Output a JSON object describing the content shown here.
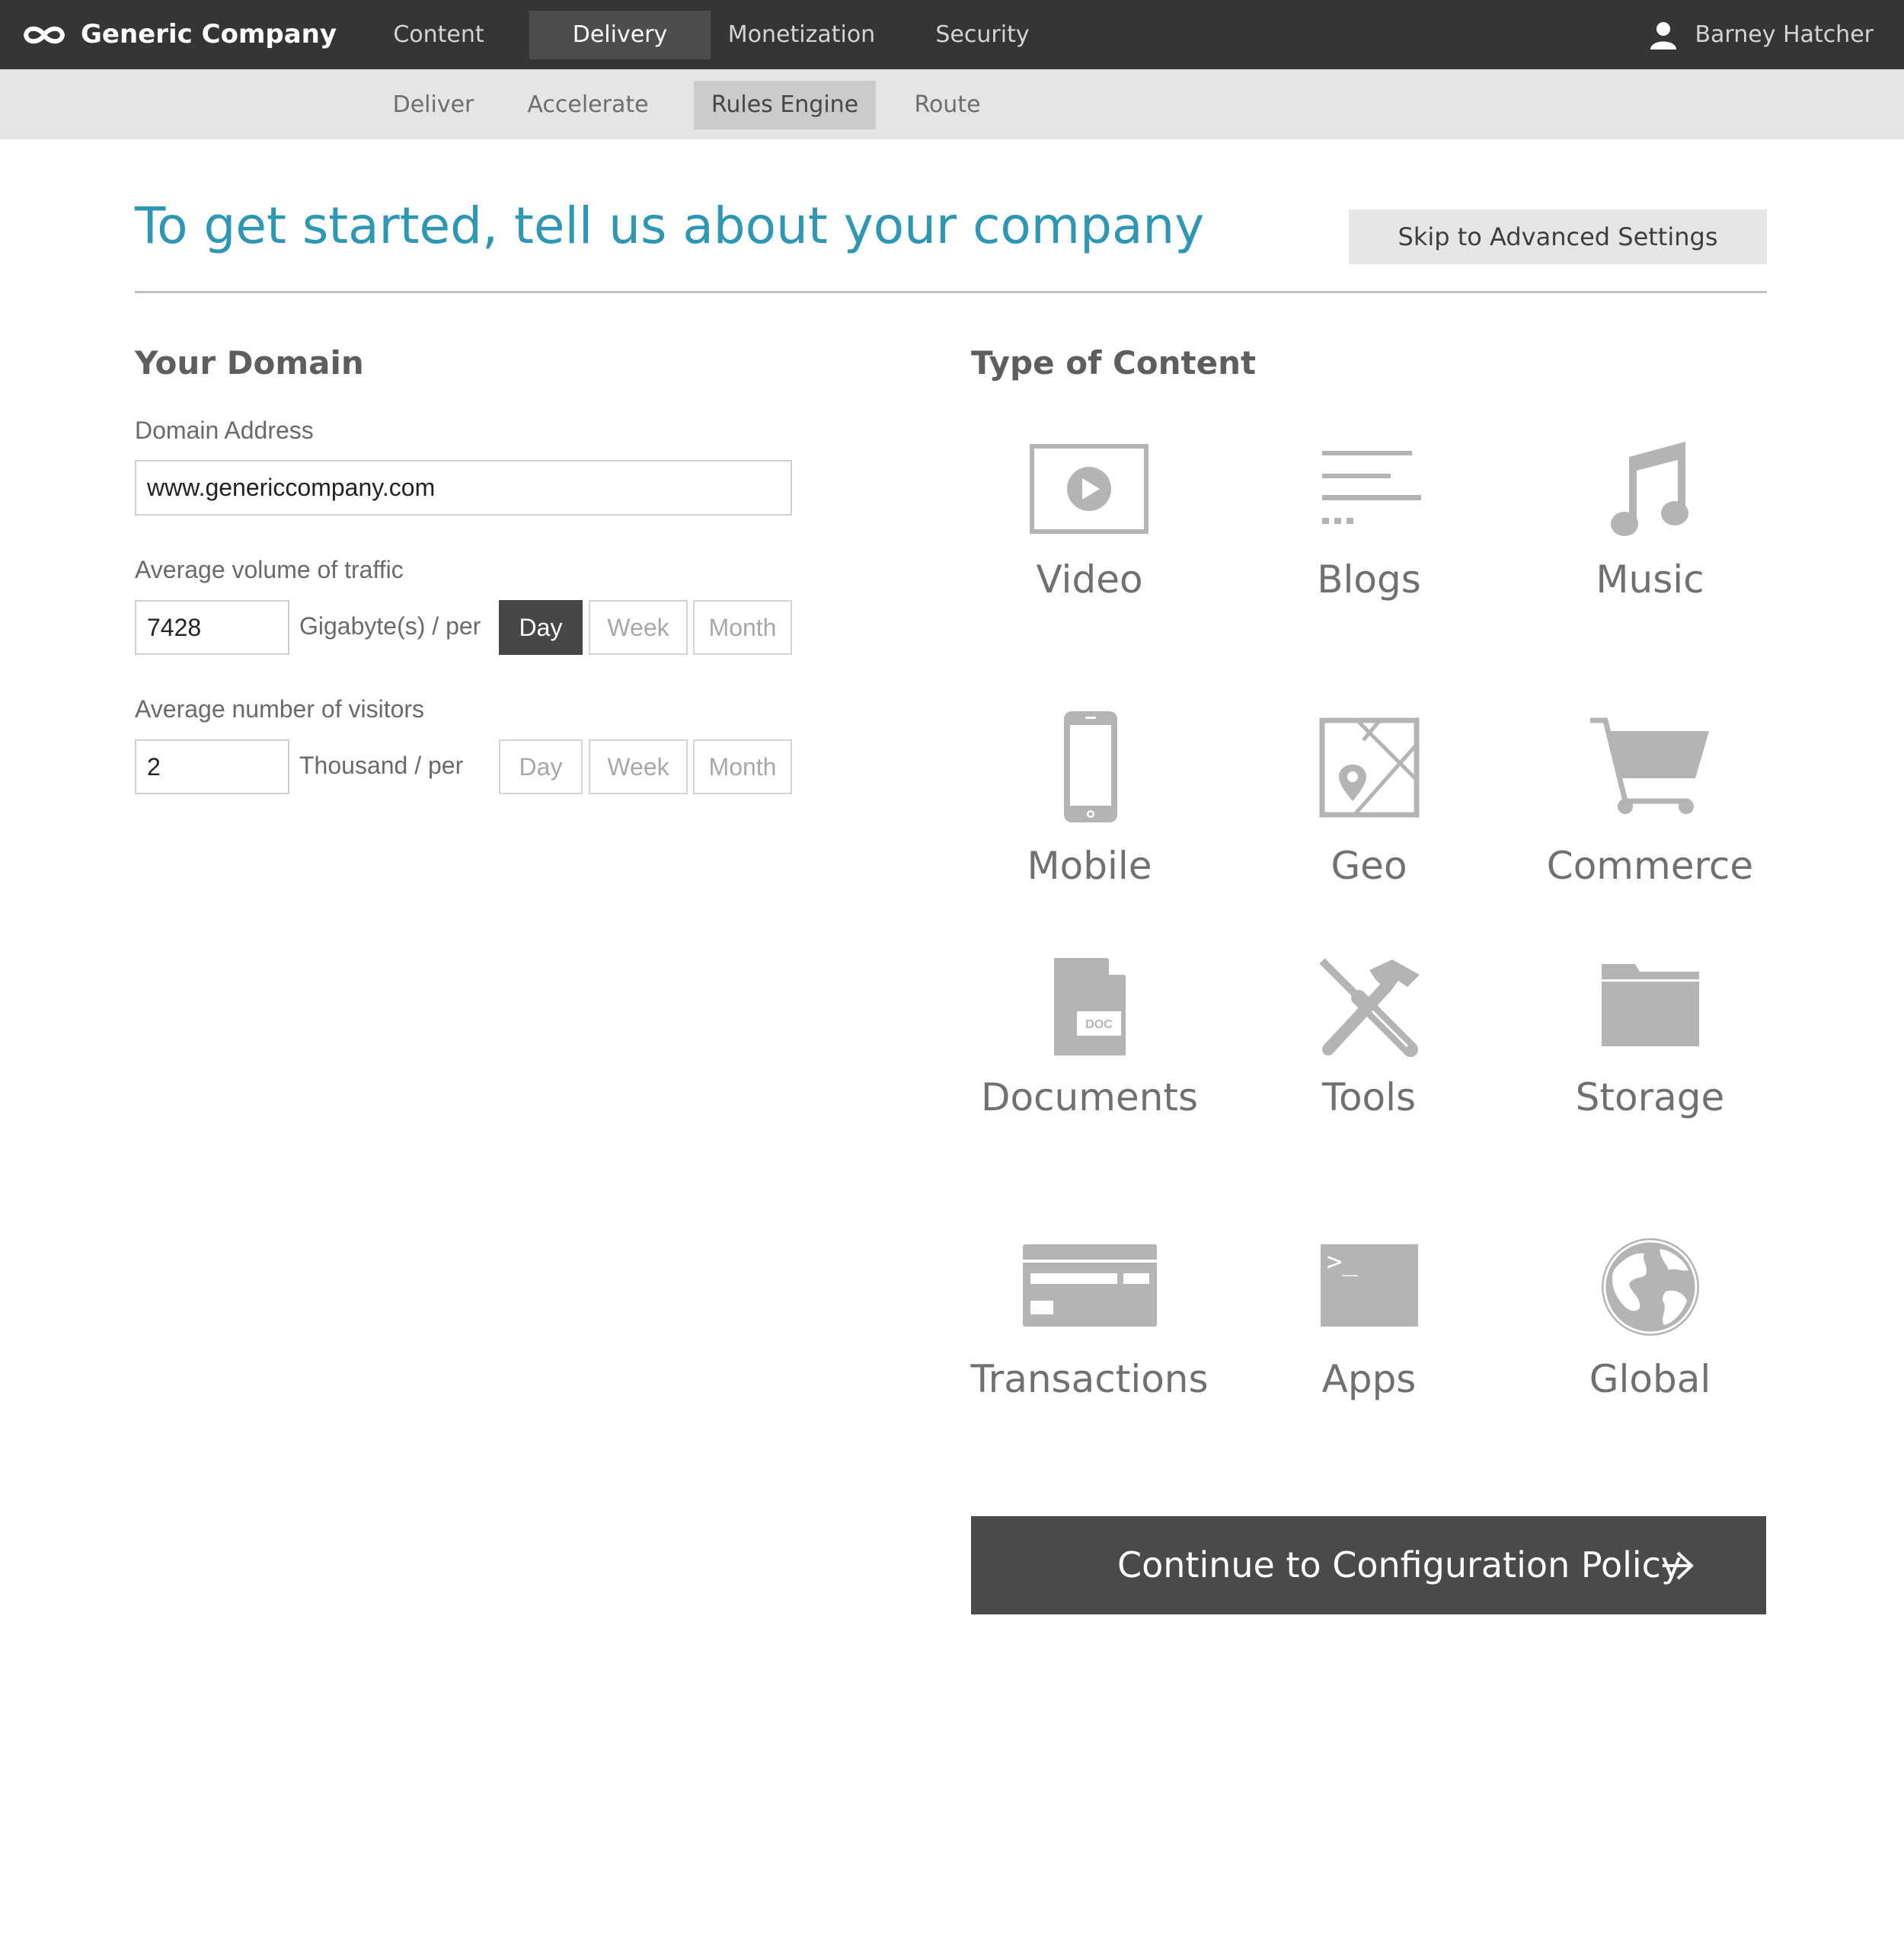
{
  "header": {
    "brand": "Generic Company",
    "logo_icon": "infinity-icon",
    "tabs": [
      {
        "label": "Content",
        "active": false
      },
      {
        "label": "Delivery",
        "active": true
      },
      {
        "label": "Monetization",
        "active": false
      },
      {
        "label": "Security",
        "active": false
      }
    ],
    "user": {
      "name": "Barney Hatcher",
      "icon": "user-icon"
    }
  },
  "subnav": {
    "tabs": [
      {
        "label": "Deliver",
        "active": false
      },
      {
        "label": "Accelerate",
        "active": false
      },
      {
        "label": "Rules Engine",
        "active": true
      },
      {
        "label": "Route",
        "active": false
      }
    ]
  },
  "page": {
    "title": "To get started, tell us about your company",
    "skip_label": "Skip to Advanced Settings"
  },
  "domain_section": {
    "title": "Your Domain",
    "domain_label": "Domain Address",
    "domain_value": "www.genericcompany.com",
    "traffic": {
      "label": "Average volume of traffic",
      "value": "7428",
      "unit": "Gigabyte(s) / per",
      "periods": [
        "Day",
        "Week",
        "Month"
      ],
      "selected": "Day"
    },
    "visitors": {
      "label": "Average number of visitors",
      "value": "2",
      "unit": "Thousand / per",
      "periods": [
        "Day",
        "Week",
        "Month"
      ],
      "selected": null
    }
  },
  "content_section": {
    "title": "Type of Content",
    "types": [
      {
        "label": "Video",
        "icon": "video-icon"
      },
      {
        "label": "Blogs",
        "icon": "blog-icon"
      },
      {
        "label": "Music",
        "icon": "music-note-icon"
      },
      {
        "label": "Mobile",
        "icon": "mobile-phone-icon"
      },
      {
        "label": "Geo",
        "icon": "map-pin-icon"
      },
      {
        "label": "Commerce",
        "icon": "shopping-cart-icon"
      },
      {
        "label": "Documents",
        "icon": "document-icon"
      },
      {
        "label": "Tools",
        "icon": "tools-icon"
      },
      {
        "label": "Storage",
        "icon": "folder-icon"
      },
      {
        "label": "Transactions",
        "icon": "credit-card-icon"
      },
      {
        "label": "Apps",
        "icon": "terminal-icon"
      },
      {
        "label": "Global",
        "icon": "globe-icon"
      }
    ],
    "doc_badge": "DOC",
    "terminal_prompt": ">_"
  },
  "continue_label": "Continue to Configuration Policy",
  "colors": {
    "topbar": "#353535",
    "subbar": "#e5e5e5",
    "accent": "#2e97b5",
    "active_dark": "#474747",
    "icon_gray": "#b4b4b4"
  }
}
